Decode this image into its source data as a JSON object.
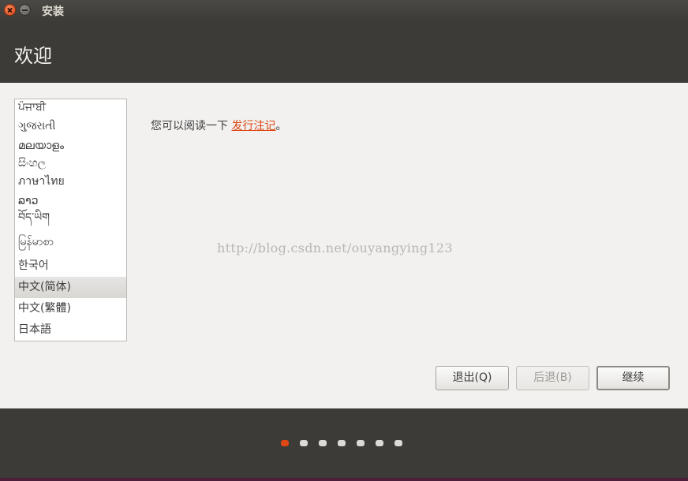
{
  "window": {
    "title": "安装"
  },
  "page": {
    "title": "欢迎"
  },
  "languages": [
    "ਪੰਜਾਬੀ",
    "ગુજરાતી",
    "മലയാളം",
    "සිංහල",
    "ภาษาไทย",
    "ລາວ",
    "བོད་ཡིག",
    "မြန်မာစာ",
    "한국어",
    "中文(简体)",
    "中文(繁體)",
    "日本語"
  ],
  "selected_language": "中文(简体)",
  "release": {
    "prefix": "您可以阅读一下 ",
    "link": "发行注记",
    "suffix": "。"
  },
  "watermark": "http://blog.csdn.net/ouyangying123",
  "buttons": {
    "quit": "退出(Q)",
    "back": "后退(B)",
    "continue": "继续"
  },
  "progress": {
    "total_steps": 7,
    "current_step": 1
  },
  "colors": {
    "accent": "#dd4814",
    "panel": "#f2f1f0",
    "chrome": "#3c3b37"
  }
}
